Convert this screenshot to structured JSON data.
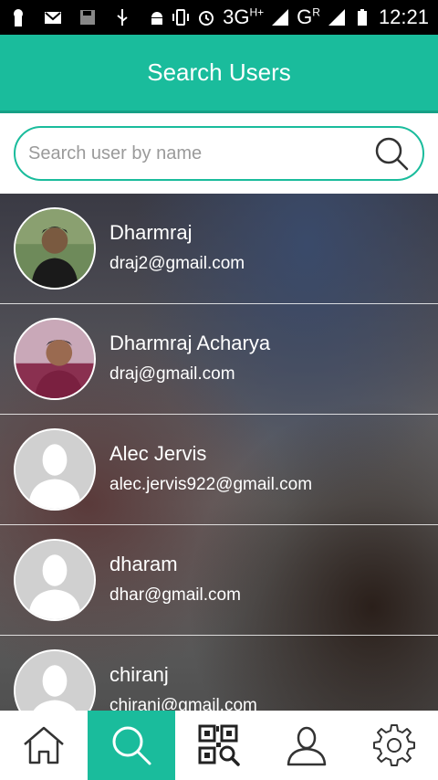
{
  "status_bar": {
    "network": "3G",
    "network_sup": "H+",
    "carrier2": "G",
    "carrier2_sup": "R",
    "time": "12:21"
  },
  "header": {
    "title": "Search Users"
  },
  "search": {
    "placeholder": "Search user by name",
    "value": ""
  },
  "users": [
    {
      "name": "Dharmraj",
      "email": "draj2@gmail.com",
      "avatar": "photo-1"
    },
    {
      "name": "Dharmraj Acharya",
      "email": "draj@gmail.com",
      "avatar": "photo-2"
    },
    {
      "name": "Alec Jervis",
      "email": "alec.jervis922@gmail.com",
      "avatar": "placeholder"
    },
    {
      "name": "dharam",
      "email": "dhar@gmail.com",
      "avatar": "placeholder"
    },
    {
      "name": "chiranj",
      "email": "chiranj@gmail.com",
      "avatar": "placeholder"
    }
  ],
  "nav": {
    "items": [
      {
        "id": "home",
        "icon": "home-icon",
        "active": false
      },
      {
        "id": "search",
        "icon": "search-icon",
        "active": true
      },
      {
        "id": "qr",
        "icon": "qr-search-icon",
        "active": false
      },
      {
        "id": "profile",
        "icon": "user-icon",
        "active": false
      },
      {
        "id": "settings",
        "icon": "gear-icon",
        "active": false
      }
    ]
  },
  "colors": {
    "accent": "#1abc9c",
    "accent_dark": "#16a085"
  }
}
